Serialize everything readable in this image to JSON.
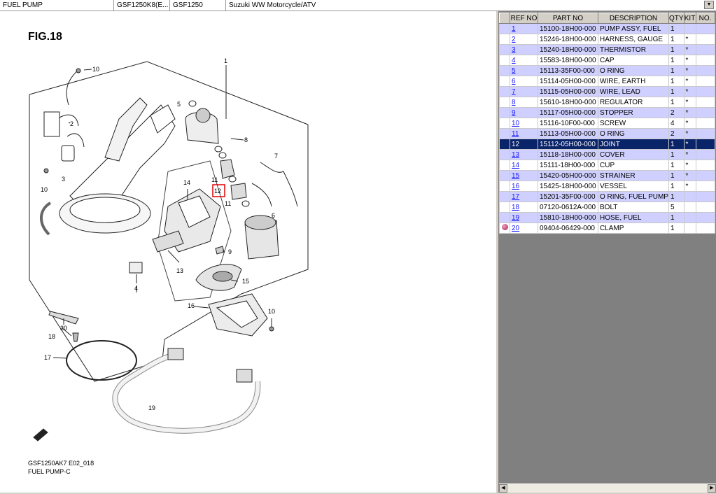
{
  "toolbar": {
    "cells": [
      "FUEL PUMP",
      "GSF1250K8(E...",
      "GSF1250",
      "Suzuki WW Motorcycle/ATV"
    ],
    "dropdown_icon": "triangle-down-icon"
  },
  "diagram": {
    "fig_title": "FIG.18",
    "footer_line1": "GSF1250AK7 E02_018",
    "footer_line2": "FUEL PUMP-C",
    "callouts": [
      "1",
      "2",
      "3",
      "4",
      "5",
      "6",
      "7",
      "8",
      "9",
      "10",
      "10",
      "10",
      "11",
      "11",
      "12",
      "13",
      "14",
      "15",
      "16",
      "17",
      "18",
      "19",
      "20"
    ],
    "highlighted_callout": "12"
  },
  "parts_table": {
    "headers": [
      "REF NO",
      "PART NO",
      "DESCRIPTION",
      "QTY",
      "KIT",
      "NO."
    ],
    "rows": [
      {
        "ref": "1",
        "part": "15100-18H00-000",
        "desc": "PUMP ASSY, FUEL",
        "qty": "1",
        "kit": ""
      },
      {
        "ref": "2",
        "part": "15246-18H00-000",
        "desc": "HARNESS, GAUGE",
        "qty": "1",
        "kit": "*"
      },
      {
        "ref": "3",
        "part": "15240-18H00-000",
        "desc": "THERMISTOR",
        "qty": "1",
        "kit": "*"
      },
      {
        "ref": "4",
        "part": "15583-18H00-000",
        "desc": "CAP",
        "qty": "1",
        "kit": "*"
      },
      {
        "ref": "5",
        "part": "15113-35F00-000",
        "desc": "O RING",
        "qty": "1",
        "kit": "*"
      },
      {
        "ref": "6",
        "part": "15114-05H00-000",
        "desc": "WIRE, EARTH",
        "qty": "1",
        "kit": "*"
      },
      {
        "ref": "7",
        "part": "15115-05H00-000",
        "desc": "WIRE, LEAD",
        "qty": "1",
        "kit": "*"
      },
      {
        "ref": "8",
        "part": "15610-18H00-000",
        "desc": "REGULATOR",
        "qty": "1",
        "kit": "*"
      },
      {
        "ref": "9",
        "part": "15117-05H00-000",
        "desc": "STOPPER",
        "qty": "2",
        "kit": "*"
      },
      {
        "ref": "10",
        "part": "15116-10F00-000",
        "desc": "SCREW",
        "qty": "4",
        "kit": "*"
      },
      {
        "ref": "11",
        "part": "15113-05H00-000",
        "desc": "O RING",
        "qty": "2",
        "kit": "*"
      },
      {
        "ref": "12",
        "part": "15112-05H00-000",
        "desc": "JOINT",
        "qty": "1",
        "kit": "*"
      },
      {
        "ref": "13",
        "part": "15118-18H00-000",
        "desc": "COVER",
        "qty": "1",
        "kit": "*"
      },
      {
        "ref": "14",
        "part": "15111-18H00-000",
        "desc": "CUP",
        "qty": "1",
        "kit": "*"
      },
      {
        "ref": "15",
        "part": "15420-05H00-000",
        "desc": "STRAINER",
        "qty": "1",
        "kit": "*"
      },
      {
        "ref": "16",
        "part": "15425-18H00-000",
        "desc": "VESSEL",
        "qty": "1",
        "kit": "*"
      },
      {
        "ref": "17",
        "part": "15201-35F00-000",
        "desc": "O RING, FUEL PUMP",
        "qty": "1",
        "kit": ""
      },
      {
        "ref": "18",
        "part": "07120-0612A-000",
        "desc": "BOLT",
        "qty": "5",
        "kit": ""
      },
      {
        "ref": "19",
        "part": "15810-18H00-000",
        "desc": "HOSE, FUEL",
        "qty": "1",
        "kit": ""
      },
      {
        "ref": "20",
        "part": "09404-06429-000",
        "desc": "CLAMP",
        "qty": "1",
        "kit": ""
      }
    ],
    "selected_ref": "12",
    "row_20_icon": "globe-icon"
  },
  "colors": {
    "row_tint": "#cfd0ff",
    "selected_row": "#0a246a",
    "highlight_box": "#e00000",
    "link": "#1a1aff"
  }
}
